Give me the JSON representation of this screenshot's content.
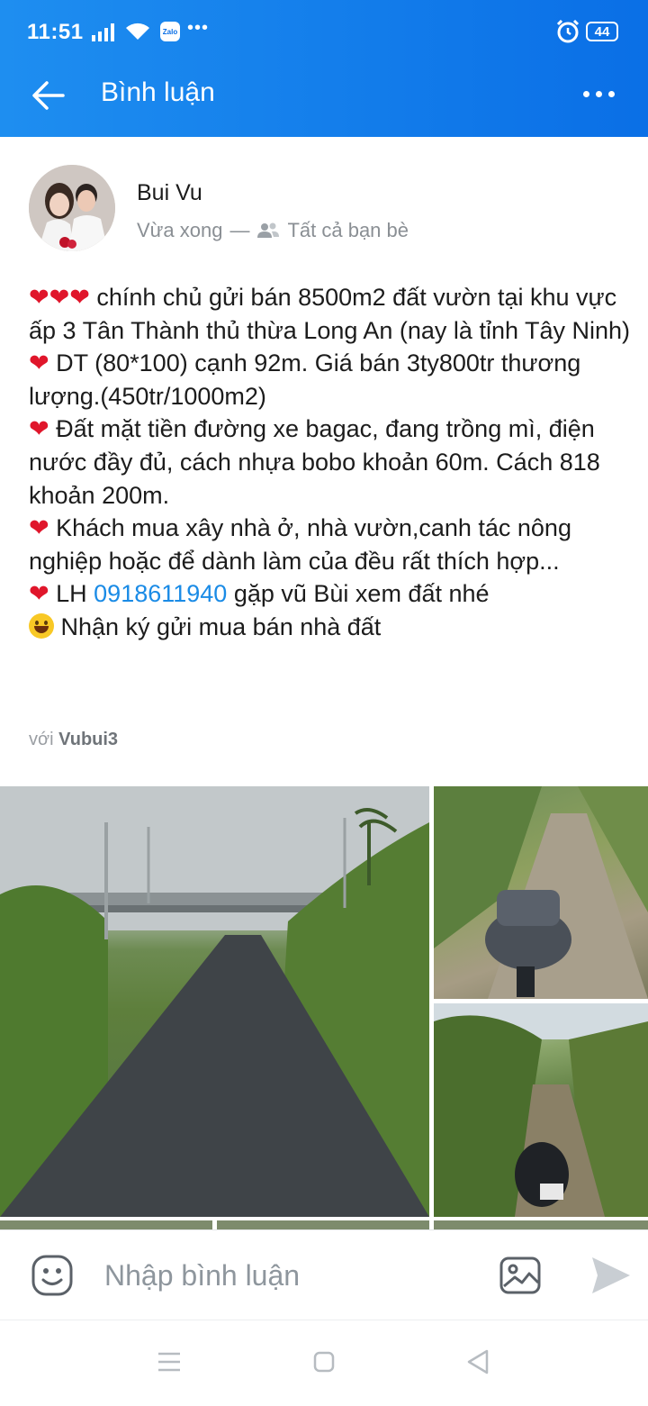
{
  "status_bar": {
    "time": "11:51",
    "notification_app": "Zalo",
    "more": "•••",
    "battery": "44"
  },
  "app_bar": {
    "title": "Bình luận"
  },
  "post": {
    "author": "Bui Vu",
    "time": "Vừa xong",
    "separator": "—",
    "audience": "Tất cả bạn bè",
    "lines": [
      {
        "emoji": "❤❤❤",
        "text": " chính chủ gửi bán 8500m2 đất vườn tại khu vực ấp 3 Tân Thành thủ thừa Long An (nay là tỉnh Tây Ninh)"
      },
      {
        "emoji": "❤",
        "text": " DT (80*100) cạnh 92m. Giá bán 3ty800tr thương lượng.(450tr/1000m2)"
      },
      {
        "emoji": "❤",
        "text": " Đất mặt tiền đường xe bagac, đang trồng mì, điện nước đầy đủ, cách nhựa bobo khoản 60m. Cách 818 khoản 200m."
      },
      {
        "emoji": "❤",
        "text": " Khách mua xây nhà ở, nhà vườn,canh tác nông nghiệp hoặc để dành làm của đều rất thích hợp..."
      }
    ],
    "contact_prefix": " LH ",
    "phone": "0918611940",
    "contact_suffix": " gặp vũ Bùi xem đất nhé",
    "last_line": " Nhận ký gửi mua bán nhà đất",
    "tag_prefix": "với",
    "tagged_user": "Vubui3"
  },
  "comment_bar": {
    "placeholder": "Nhập bình luận"
  },
  "icons": {
    "back": "arrow-left-icon",
    "overflow": "more-horizontal-icon",
    "audience": "friends-icon",
    "emoji": "sticker-icon",
    "image": "image-icon",
    "send": "send-icon"
  },
  "colors": {
    "app_bar_start": "#1e8ef0",
    "app_bar_end": "#0a6fe6",
    "link": "#1a8be6",
    "heart": "#e0162b"
  }
}
